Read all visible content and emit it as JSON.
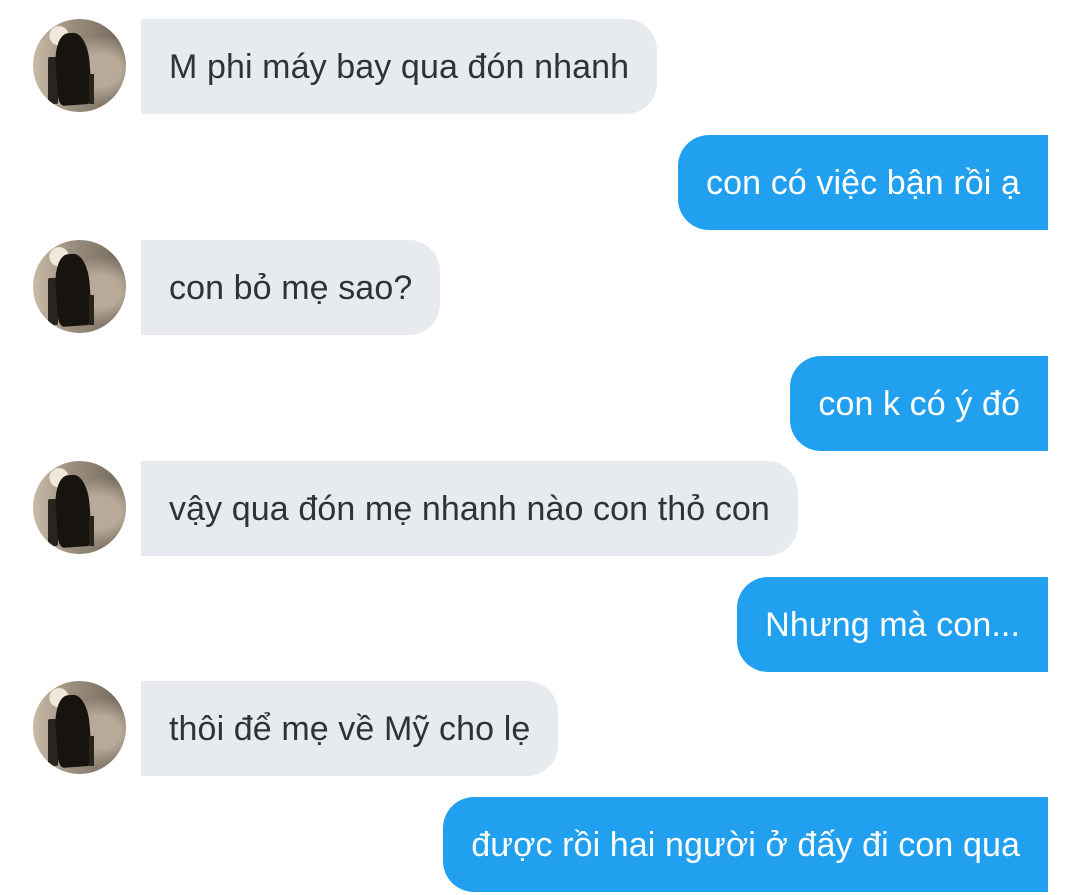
{
  "conversation": {
    "messages": [
      {
        "sender": "other",
        "text": "M phi máy bay qua đón nhanh"
      },
      {
        "sender": "me",
        "text": "con có việc bận rồi ạ"
      },
      {
        "sender": "other",
        "text": "con bỏ mẹ sao?"
      },
      {
        "sender": "me",
        "text": "con k có ý đó"
      },
      {
        "sender": "other",
        "text": "vậy qua đón mẹ nhanh nào con thỏ con"
      },
      {
        "sender": "me",
        "text": "Nhưng mà con..."
      },
      {
        "sender": "other",
        "text": "thôi để mẹ về Mỹ cho lẹ"
      },
      {
        "sender": "me",
        "text": "được rồi hai người ở đấy đi con qua"
      }
    ]
  },
  "colors": {
    "incoming_bubble": "#e7ebf0",
    "outgoing_bubble": "#22a0f0",
    "incoming_text": "#2f3338",
    "outgoing_text": "#ffffff",
    "background": "#ffffff"
  }
}
